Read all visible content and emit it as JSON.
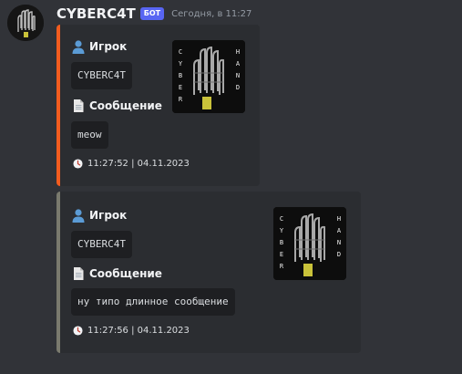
{
  "message": {
    "username": "CYBERC4T",
    "bot_tag": "БОТ",
    "timestamp": "Сегодня, в 11:27"
  },
  "embeds": [
    {
      "accent_color": "#f25c1f",
      "player_label": "Игрок",
      "player_value": "CYBERC4T",
      "message_label": "Сообщение",
      "message_value": "meow",
      "footer_time": "11:27:52 | 04.11.2023",
      "thumbnail_letters_left": "CYBER",
      "thumbnail_letters_right": "HAND"
    },
    {
      "accent_color": "#7a7a6e",
      "player_label": "Игрок",
      "player_value": "CYBERC4T",
      "message_label": "Сообщение",
      "message_value": "ну типо длинное сообщение",
      "footer_time": "11:27:56 | 04.11.2023",
      "thumbnail_letters_left": "CYBER",
      "thumbnail_letters_right": "HAND"
    }
  ],
  "icons": {
    "user": "bust-in-silhouette-icon",
    "document": "page-facing-up-icon",
    "clock": "clock-icon"
  }
}
